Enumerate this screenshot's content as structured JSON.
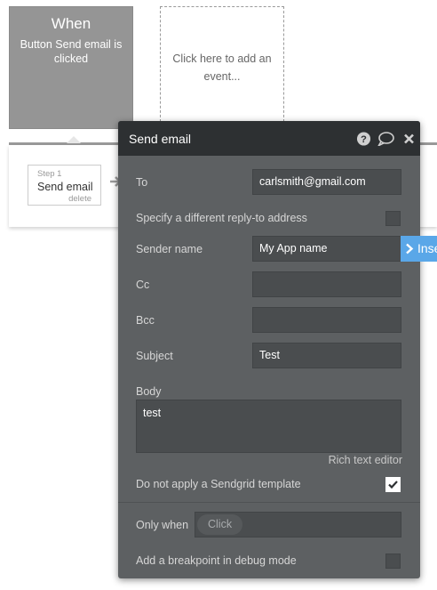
{
  "when_card": {
    "title": "When",
    "description": "Button Send email is clicked"
  },
  "add_event": {
    "label": "Click here to add an event..."
  },
  "step": {
    "number_label": "Step 1",
    "name": "Send email",
    "delete_label": "delete"
  },
  "panel": {
    "title": "Send email",
    "icons": [
      "help-icon",
      "comment-icon",
      "close-icon"
    ],
    "to": {
      "label": "To",
      "value": "carlsmith@gmail.com"
    },
    "reply_to": {
      "label": "Specify a different reply-to address",
      "checked": false
    },
    "sender_name": {
      "label": "Sender name",
      "value": "My App name"
    },
    "cc": {
      "label": "Cc",
      "value": ""
    },
    "bcc": {
      "label": "Bcc",
      "value": ""
    },
    "subject": {
      "label": "Subject",
      "value": "Test"
    },
    "body": {
      "label": "Body",
      "value": "test"
    },
    "rich_text_label": "Rich text editor",
    "sendgrid": {
      "label": "Do not apply a Sendgrid template",
      "checked": true
    },
    "only_when": {
      "label": "Only when",
      "chip": "Click"
    },
    "breakpoint": {
      "label": "Add a breakpoint in debug mode",
      "checked": false
    }
  },
  "insert_tab": {
    "label": "Insert dynamic data",
    "color": "#5aa7e8"
  },
  "colors": {
    "panel_bg": "#5d6062",
    "panel_header": "#2d3032",
    "field_bg": "#4a4d4f",
    "when_card_bg": "#959595"
  }
}
